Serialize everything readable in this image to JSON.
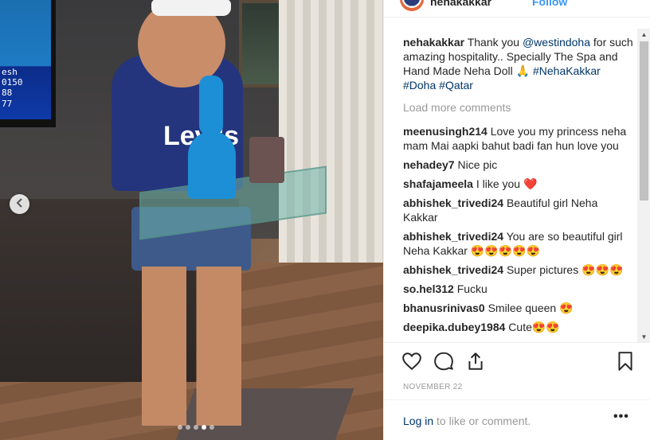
{
  "header": {
    "username": "nehakakkar",
    "follow_label": "Follow"
  },
  "tv_screen": {
    "lines": [
      "esh",
      "0150",
      "88",
      "77"
    ]
  },
  "photo": {
    "shirt_text": "Levi's"
  },
  "caption": {
    "user": "nehakakkar",
    "text_1": " Thank you ",
    "mention": "@westindoha",
    "text_2": " for such amazing hospitality.. Specially The Spa and Hand Made Neha Doll 🙏 ",
    "hashtag_1": "#NehaKakkar",
    "hashtag_2": "#Doha",
    "hashtag_3": "#Qatar"
  },
  "load_more": "Load more comments",
  "comments": [
    {
      "user": "meenusingh214",
      "text": " Love you my princess neha mam Mai aapki bahut badi fan hun love you"
    },
    {
      "user": "nehadey7",
      "text": " Nice pic"
    },
    {
      "user": "shafajameela",
      "text": " I like you ❤️"
    },
    {
      "user": "abhishek_trivedi24",
      "text": " Beautiful girl Neha Kakkar"
    },
    {
      "user": "abhishek_trivedi24",
      "text": " You are so beautiful girl Neha Kakkar 😍😍😍😍😍"
    },
    {
      "user": "abhishek_trivedi24",
      "text": " Super pictures 😍😍😍"
    },
    {
      "user": "so.hel312",
      "text": " Fucku"
    },
    {
      "user": "bhanusrinivas0",
      "text": " Smilee queen 😍"
    },
    {
      "user": "deepika.dubey1984",
      "text": " Cute😍😍"
    }
  ],
  "date": "NOVEMBER 22",
  "footer": {
    "login_link": "Log in",
    "login_rest": " to like or comment.",
    "more": "•••"
  },
  "icons": {
    "like": "heart-icon",
    "comment": "comment-icon",
    "share": "share-icon",
    "save": "bookmark-icon",
    "prev": "chevron-left-icon"
  }
}
